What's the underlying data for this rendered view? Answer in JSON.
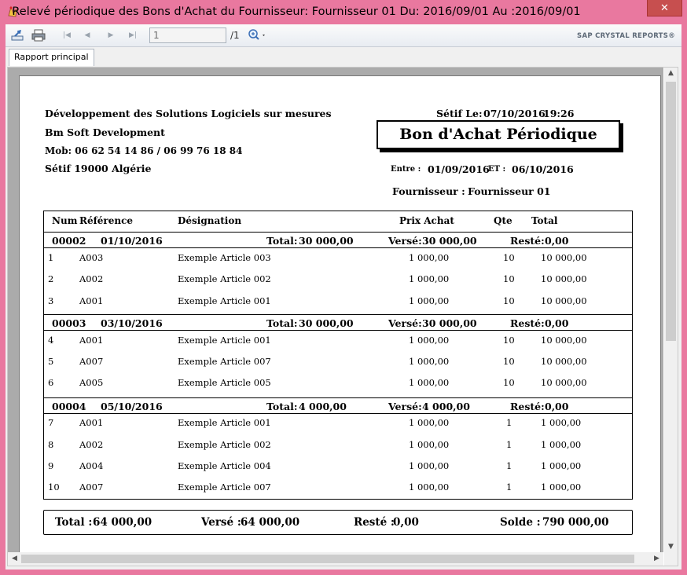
{
  "window": {
    "title": "Relevé périodique des Bons d'Achat du Fournisseur: Fournisseur 01 Du: 2016/09/01 Au :2016/09/01",
    "close_glyph": "✕"
  },
  "toolbar": {
    "page_value": "1",
    "page_total": "/1",
    "brand": "SAP CRYSTAL REPORTS®"
  },
  "tabs": [
    {
      "label": "Rapport principal"
    }
  ],
  "report": {
    "company": {
      "line1": "Développement des Solutions Logiciels sur mesures",
      "line2": "Bm Soft Development",
      "line3": "Mob: 06 62 54 14 86 / 06 99 76 18 84",
      "line4": "Sétif 19000  Algérie"
    },
    "date_label": "Sétif Le:",
    "date_value": "07/10/2016",
    "time_value": "19:26",
    "title": "Bon d'Achat Périodique",
    "entre_label": "Entre :",
    "entre_value": "01/09/2016",
    "et_label": "ET :",
    "et_value": "06/10/2016",
    "supplier_label": "Fournisseur :",
    "supplier_value": "Fournisseur 01",
    "columns": {
      "num": "Num",
      "ref": "Référence",
      "designation": "Désignation",
      "price": "Prix Achat",
      "qty": "Qte",
      "total": "Total"
    },
    "groups": [
      {
        "code": "00002",
        "date": "01/10/2016",
        "total_label": "Total:",
        "total": "30 000,00",
        "paid_label": "Versé:",
        "paid": "30 000,00",
        "rest_label": "Resté:",
        "rest": "0,00",
        "rows": [
          {
            "num": "1",
            "ref": "A003",
            "designation": "Exemple Article 003",
            "price": "1 000,00",
            "qty": "10",
            "total": "10 000,00"
          },
          {
            "num": "2",
            "ref": "A002",
            "designation": "Exemple Article 002",
            "price": "1 000,00",
            "qty": "10",
            "total": "10 000,00"
          },
          {
            "num": "3",
            "ref": "A001",
            "designation": "Exemple Article 001",
            "price": "1 000,00",
            "qty": "10",
            "total": "10 000,00"
          }
        ]
      },
      {
        "code": "00003",
        "date": "03/10/2016",
        "total_label": "Total:",
        "total": "30 000,00",
        "paid_label": "Versé:",
        "paid": "30 000,00",
        "rest_label": "Resté:",
        "rest": "0,00",
        "rows": [
          {
            "num": "4",
            "ref": "A001",
            "designation": "Exemple Article 001",
            "price": "1 000,00",
            "qty": "10",
            "total": "10 000,00"
          },
          {
            "num": "5",
            "ref": "A007",
            "designation": "Exemple Article 007",
            "price": "1 000,00",
            "qty": "10",
            "total": "10 000,00"
          },
          {
            "num": "6",
            "ref": "A005",
            "designation": "Exemple Article 005",
            "price": "1 000,00",
            "qty": "10",
            "total": "10 000,00"
          }
        ]
      },
      {
        "code": "00004",
        "date": "05/10/2016",
        "total_label": "Total:",
        "total": "4 000,00",
        "paid_label": "Versé:",
        "paid": "4 000,00",
        "rest_label": "Resté:",
        "rest": "0,00",
        "rows": [
          {
            "num": "7",
            "ref": "A001",
            "designation": "Exemple Article 001",
            "price": "1 000,00",
            "qty": "1",
            "total": "1 000,00"
          },
          {
            "num": "8",
            "ref": "A002",
            "designation": "Exemple Article 002",
            "price": "1 000,00",
            "qty": "1",
            "total": "1 000,00"
          },
          {
            "num": "9",
            "ref": "A004",
            "designation": "Exemple Article 004",
            "price": "1 000,00",
            "qty": "1",
            "total": "1 000,00"
          },
          {
            "num": "10",
            "ref": "A007",
            "designation": "Exemple Article 007",
            "price": "1 000,00",
            "qty": "1",
            "total": "1 000,00"
          }
        ]
      }
    ],
    "footer": {
      "total_label": "Total :",
      "total": "64 000,00",
      "paid_label": "Versé :",
      "paid": "64 000,00",
      "rest_label": "Resté :",
      "rest": "0,00",
      "balance_label": "Solde :",
      "balance": "790 000,00"
    }
  }
}
